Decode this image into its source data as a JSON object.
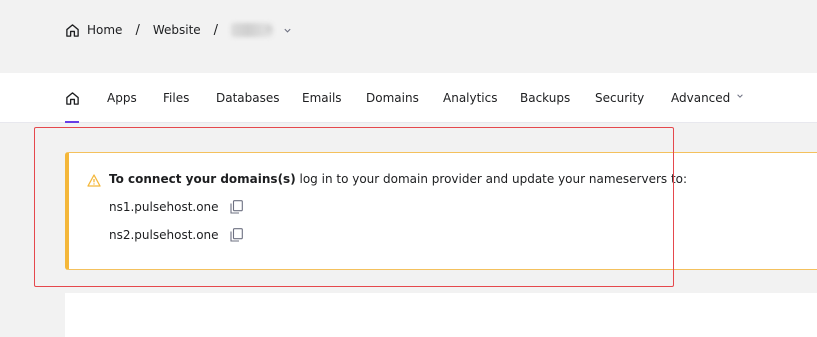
{
  "breadcrumb": {
    "home_label": "Home",
    "website_label": "Website",
    "site_name": "h"
  },
  "nav": {
    "tabs": [
      {
        "label": "Apps"
      },
      {
        "label": "Files"
      },
      {
        "label": "Databases"
      },
      {
        "label": "Emails"
      },
      {
        "label": "Domains"
      },
      {
        "label": "Analytics"
      },
      {
        "label": "Backups"
      },
      {
        "label": "Security"
      },
      {
        "label": "Advanced"
      }
    ],
    "active_color": "#673de6"
  },
  "notice": {
    "title": "To connect your domains(s)",
    "message": " log in to your domain provider and update your nameservers to:",
    "nameservers": [
      "ns1.pulsehost.one",
      "ns2.pulsehost.one"
    ],
    "accent_color": "#f4b73a",
    "highlight_color": "#e5484d"
  }
}
